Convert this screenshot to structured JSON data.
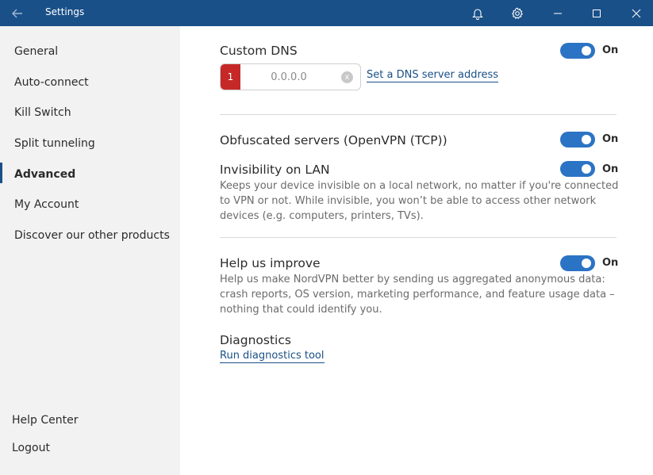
{
  "window": {
    "title": "Settings"
  },
  "sidebar": {
    "items": [
      {
        "label": "General"
      },
      {
        "label": "Auto-connect"
      },
      {
        "label": "Kill Switch"
      },
      {
        "label": "Split tunneling"
      },
      {
        "label": "Advanced",
        "active": true
      },
      {
        "label": "My Account"
      },
      {
        "label": "Discover our other products"
      }
    ],
    "footer": [
      {
        "label": "Help Center"
      },
      {
        "label": "Logout"
      }
    ]
  },
  "settings": {
    "custom_dns": {
      "title": "Custom DNS",
      "toggle_label": "On",
      "badge": "1",
      "input_placeholder": "0.0.0.0",
      "clear_glyph": "x",
      "link": "Set a DNS server address"
    },
    "obfuscated": {
      "title": "Obfuscated servers (OpenVPN (TCP))",
      "toggle_label": "On"
    },
    "invisibility": {
      "title": "Invisibility on LAN",
      "toggle_label": "On",
      "description": "Keeps your device invisible on a local network, no matter if you're connected to VPN or not. While invisible, you won’t be able to access other network devices (e.g. computers, printers, TVs)."
    },
    "help_improve": {
      "title": "Help us improve",
      "toggle_label": "On",
      "description": "Help us make NordVPN better by sending us aggregated anonymous data: crash reports, OS version, marketing performance, and feature usage data – nothing that could identify you."
    },
    "diagnostics": {
      "title": "Diagnostics",
      "link": "Run diagnostics tool"
    }
  },
  "colors": {
    "titlebar": "#1a5088",
    "toggle_on": "#2b73c4",
    "badge": "#c62828"
  }
}
